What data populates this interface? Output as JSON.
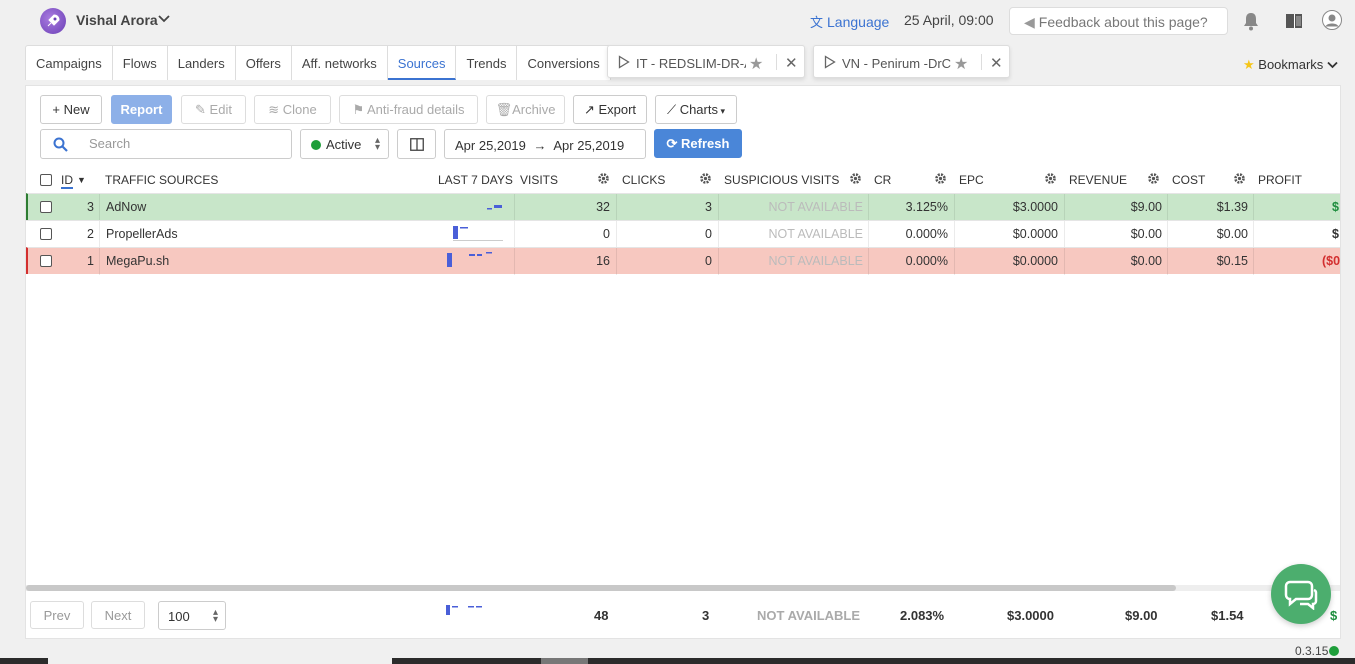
{
  "header": {
    "user_name": "Vishal Arora",
    "language_label": "Language",
    "datetime": "25 April, 09:00",
    "feedback_label": "Feedback about this page?"
  },
  "tabs": [
    {
      "label": "Campaigns",
      "active": false
    },
    {
      "label": "Flows",
      "active": false
    },
    {
      "label": "Landers",
      "active": false
    },
    {
      "label": "Offers",
      "active": false
    },
    {
      "label": "Aff. networks",
      "active": false
    },
    {
      "label": "Sources",
      "active": true
    },
    {
      "label": "Trends",
      "active": false
    },
    {
      "label": "Conversions",
      "active": false
    }
  ],
  "campaign_tabs": [
    {
      "label": "IT - REDSLIM-DR-A"
    },
    {
      "label": "VN - Penirum -DrC"
    }
  ],
  "bookmarks_label": "Bookmarks",
  "toolbar": {
    "new": "New",
    "report": "Report",
    "edit": "Edit",
    "clone": "Clone",
    "antifraud": "Anti-fraud details",
    "archive": "Archive",
    "export": "Export",
    "charts": "Charts",
    "search_placeholder": "Search",
    "status": "Active",
    "date_from": "Apr 25,2019",
    "date_to": "Apr 25,2019",
    "refresh": "Refresh"
  },
  "table": {
    "headers": {
      "id": "ID",
      "name": "TRAFFIC SOURCES",
      "last7": "LAST 7 DAYS",
      "visits": "VISITS",
      "clicks": "CLICKS",
      "suspicious": "SUSPICIOUS VISITS",
      "cr": "CR",
      "epc": "EPC",
      "revenue": "REVENUE",
      "cost": "COST",
      "profit": "PROFIT"
    },
    "rows": [
      {
        "id": "3",
        "name": "AdNow",
        "visits": "32",
        "clicks": "3",
        "suspicious": "NOT AVAILABLE",
        "cr": "3.125%",
        "epc": "$3.0000",
        "revenue": "$9.00",
        "cost": "$1.39",
        "profit": "$",
        "status": "green"
      },
      {
        "id": "2",
        "name": "PropellerAds",
        "visits": "0",
        "clicks": "0",
        "suspicious": "NOT AVAILABLE",
        "cr": "0.000%",
        "epc": "$0.0000",
        "revenue": "$0.00",
        "cost": "$0.00",
        "profit": "$",
        "status": "white"
      },
      {
        "id": "1",
        "name": "MegaPu.sh",
        "visits": "16",
        "clicks": "0",
        "suspicious": "NOT AVAILABLE",
        "cr": "0.000%",
        "epc": "$0.0000",
        "revenue": "$0.00",
        "cost": "$0.15",
        "profit": "($0",
        "status": "red"
      }
    ]
  },
  "totals": {
    "visits": "48",
    "clicks": "3",
    "suspicious": "NOT AVAILABLE",
    "cr": "2.083%",
    "epc": "$3.0000",
    "revenue": "$9.00",
    "cost": "$1.54",
    "profit": "$"
  },
  "pagination": {
    "prev": "Prev",
    "next": "Next",
    "page_size": "100"
  },
  "version": "0.3.15",
  "colors": {
    "accent": "#3b73d1",
    "row_green": "#c8e6c9",
    "row_red": "#f7c8c0",
    "status_active": "#1e9e3a",
    "chat": "#4cae6e"
  }
}
